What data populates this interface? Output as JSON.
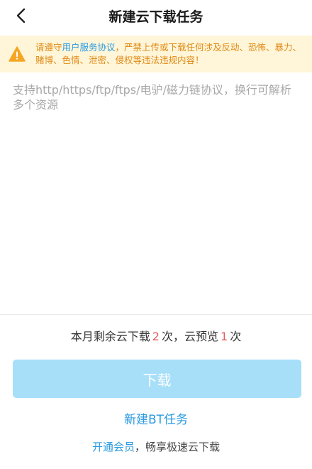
{
  "header": {
    "title": "新建云下载任务"
  },
  "notice": {
    "prefix": "请遵守",
    "link": "用户服务协议",
    "body": "，严禁上传或下载任何涉及反动、恐怖、暴力、赌博、色情、泄密、侵权等违法违规内容！"
  },
  "input": {
    "placeholder": "支持http/https/ftp/ftps/电驴/磁力链协议，换行可解析多个资源",
    "value": ""
  },
  "quota": {
    "prefix": "本月剩余云下载",
    "download_count": "2",
    "middle": "次，云预览",
    "preview_count": "1",
    "suffix": "次"
  },
  "actions": {
    "download_label": "下载",
    "bt_task_label": "新建BT任务"
  },
  "promo": {
    "link": "开通会员",
    "text": "，畅享极速云下载"
  },
  "colors": {
    "accent": "#2a9ae0",
    "warning": "#e08a16",
    "warning_bg": "#fff6d9",
    "count": "#e85a5a",
    "button_disabled": "#a7dff9"
  }
}
